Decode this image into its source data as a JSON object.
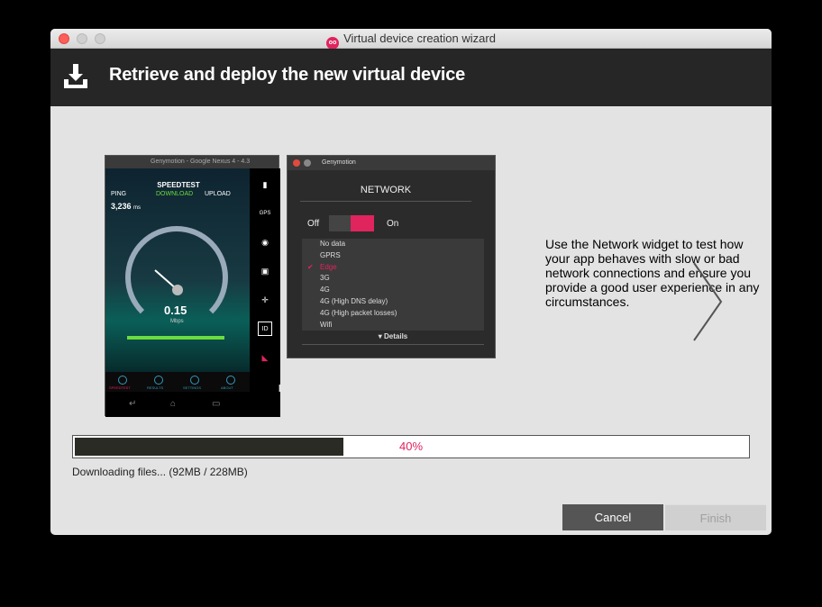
{
  "window": {
    "title": "Virtual device creation wizard",
    "app_logo_text": "oo"
  },
  "header": {
    "title": "Retrieve and deploy the new virtual device",
    "icon": "download-icon"
  },
  "phone_screenshot": {
    "title": "Genymotion - Google Nexus 4 - 4.3",
    "app_name": "SPEEDTEST",
    "ping_label": "PING",
    "download_label": "DOWNLOAD",
    "upload_label": "UPLOAD",
    "ping_value": "3,236",
    "ping_unit": "ms",
    "speed_value": "0.15",
    "speed_unit": "Mbps",
    "tabs": [
      "SPEEDTEST",
      "RESULTS",
      "SETTINGS",
      "ABOUT"
    ],
    "side_icons": [
      "battery-icon",
      "gps-icon",
      "camera-icon",
      "video-icon",
      "move-icon",
      "id-icon",
      "network-icon"
    ],
    "side_labels": {
      "gps": "GPS",
      "id": "ID"
    }
  },
  "network_widget": {
    "window_title": "Genymotion",
    "title": "NETWORK",
    "toggle_off_label": "Off",
    "toggle_on_label": "On",
    "options": [
      "No data",
      "GPRS",
      "Edge",
      "3G",
      "4G",
      "4G (High DNS delay)",
      "4G (High packet losses)",
      "Wifi"
    ],
    "selected_option": "Edge",
    "details_label": "Details"
  },
  "description": "Use the Network widget to test how your app behaves with slow or bad network connections and ensure you provide a good user experience in any circumstances.",
  "progress": {
    "percent": 40,
    "label": "40%"
  },
  "status": "Downloading files... (92MB / 228MB)",
  "buttons": {
    "cancel": "Cancel",
    "finish": "Finish"
  },
  "colors": {
    "accent": "#e0245e",
    "header_bg": "#262626",
    "progress_fill": "#2b2b25"
  }
}
